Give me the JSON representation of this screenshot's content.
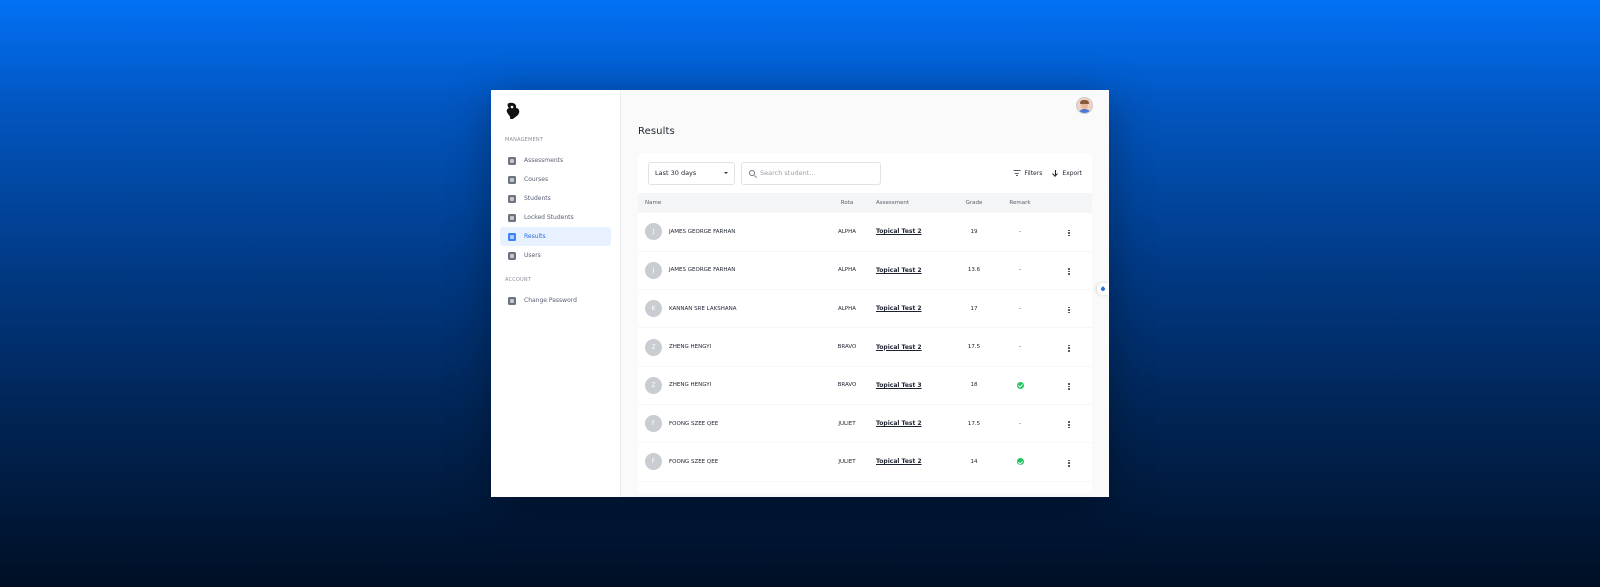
{
  "sidebar": {
    "management_label": "MANAGEMENT",
    "account_label": "ACCOUNT",
    "items": [
      {
        "label": "Assessments",
        "icon": "calendar-icon",
        "active": false
      },
      {
        "label": "Courses",
        "icon": "briefcase-icon",
        "active": false
      },
      {
        "label": "Students",
        "icon": "user-icon",
        "active": false
      },
      {
        "label": "Locked Students",
        "icon": "user-lock-icon",
        "active": false
      },
      {
        "label": "Results",
        "icon": "results-icon",
        "active": true
      },
      {
        "label": "Users",
        "icon": "user-icon",
        "active": false
      }
    ],
    "account_items": [
      {
        "label": "Change Password",
        "icon": "password-icon"
      }
    ]
  },
  "header": {
    "title": "Results"
  },
  "toolbar": {
    "date_range": "Last 30 days",
    "search_placeholder": "Search student...",
    "filters_label": "Filters",
    "export_label": "Export"
  },
  "table": {
    "columns": [
      "Name",
      "Rota",
      "Assessment",
      "Grade",
      "Remark"
    ],
    "rows": [
      {
        "initial": "J",
        "name": "JAMES GEORGE FARHAN",
        "rota": "ALPHA",
        "assessment": "Topical Test 2",
        "grade": "19",
        "remark": "-"
      },
      {
        "initial": "J",
        "name": "JAMES GEORGE FARHAN",
        "rota": "ALPHA",
        "assessment": "Topical Test 2",
        "grade": "13.6",
        "remark": "-"
      },
      {
        "initial": "K",
        "name": "KANNAN SRE LAKSHANA",
        "rota": "ALPHA",
        "assessment": "Topical Test 2",
        "grade": "17",
        "remark": "-"
      },
      {
        "initial": "Z",
        "name": "ZHENG HENGYI",
        "rota": "BRAVO",
        "assessment": "Topical Test 2",
        "grade": "17.5",
        "remark": "-"
      },
      {
        "initial": "Z",
        "name": "ZHENG HENGYI",
        "rota": "BRAVO",
        "assessment": "Topical Test 3",
        "grade": "18",
        "remark": "check"
      },
      {
        "initial": "F",
        "name": "FOONG SZEE QEE",
        "rota": "JULIET",
        "assessment": "Topical Test 2",
        "grade": "17.5",
        "remark": "-"
      },
      {
        "initial": "F",
        "name": "FOONG SZEE QEE",
        "rota": "JULIET",
        "assessment": "Topical Test 2",
        "grade": "14",
        "remark": "check"
      }
    ]
  },
  "colors": {
    "accent": "#2a6de0",
    "active_bg": "#e8f1ff",
    "success": "#22c55e"
  }
}
